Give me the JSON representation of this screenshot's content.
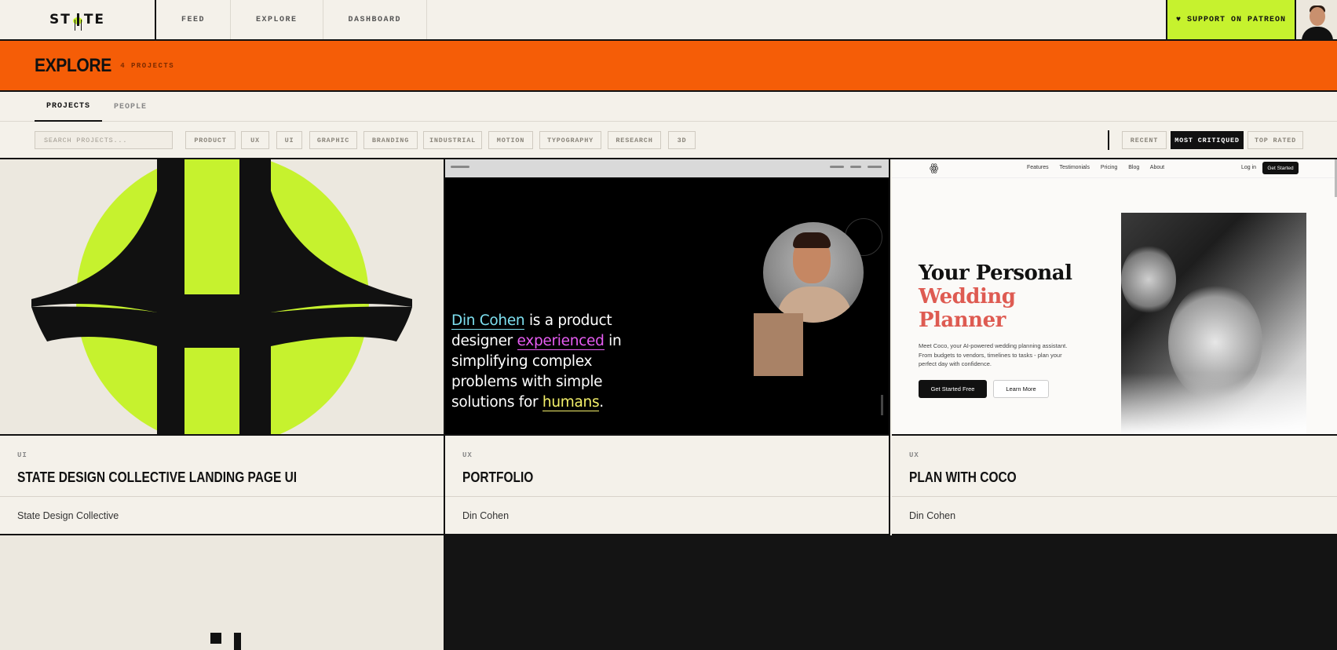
{
  "brand": {
    "logo": "ST TE"
  },
  "nav": {
    "feed": "FEED",
    "explore": "EXPLORE",
    "dashboard": "DASHBOARD",
    "patreon": "♥ SUPPORT ON PATREON"
  },
  "banner": {
    "title": "EXPLORE",
    "count": "4 PROJECTS"
  },
  "tabs": {
    "projects": "PROJECTS",
    "people": "PEOPLE"
  },
  "search": {
    "placeholder": "SEARCH PROJECTS..."
  },
  "categories": [
    "PRODUCT",
    "UX",
    "UI",
    "GRAPHIC",
    "BRANDING",
    "INDUSTRIAL",
    "MOTION",
    "TYPOGRAPHY",
    "RESEARCH",
    "3D"
  ],
  "sort": {
    "recent": "RECENT",
    "most_critiqued": "MOST CRITIQUED",
    "top_rated": "TOP RATED",
    "active": "MOST CRITIQUED"
  },
  "colors": {
    "accent_lime": "#c6f22e",
    "banner_orange": "#f55d07",
    "background": "#f4f1ea"
  },
  "projects": [
    {
      "category": "UI",
      "title": "STATE DESIGN COLLECTIVE LANDING PAGE UI",
      "author": "State Design Collective"
    },
    {
      "category": "UX",
      "title": "PORTFOLIO",
      "author": "Din Cohen",
      "preview": {
        "name": "Din Cohen",
        "t1": " is a product designer ",
        "experienced": "experienced",
        "t2": " in simplifying complex problems with simple solutions for ",
        "humans": "humans",
        "t3": "."
      }
    },
    {
      "category": "UX",
      "title": "PLAN WITH COCO",
      "author": "Din Cohen",
      "preview": {
        "logo": "ꙮ",
        "nav": "Features Testimonials Pricing Blog About",
        "login": "Log in",
        "get_started": "Get Started",
        "headline_1": "Your Personal",
        "headline_2": "Wedding Planner",
        "description": "Meet Coco, your AI-powered wedding planning assistant. From budgets to vendors, timelines to tasks - plan your perfect day with confidence.",
        "cta_primary": "Get Started Free",
        "cta_secondary": "Learn More"
      }
    }
  ]
}
